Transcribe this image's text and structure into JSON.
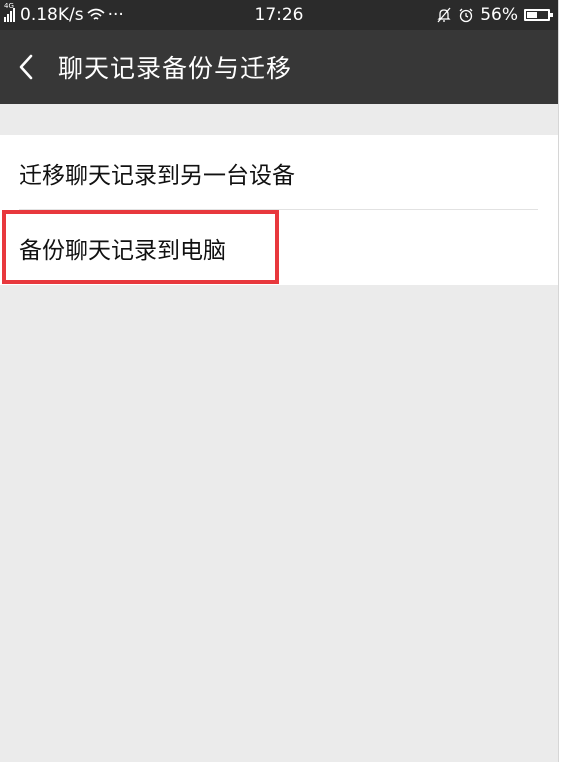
{
  "status_bar": {
    "network_type": "4G",
    "speed": "0.18K/s",
    "more": "···",
    "time": "17:26",
    "battery_percent": "56%",
    "battery_level": 0.56
  },
  "header": {
    "title": "聊天记录备份与迁移"
  },
  "list": {
    "items": [
      {
        "label": "迁移聊天记录到另一台设备"
      },
      {
        "label": "备份聊天记录到电脑"
      }
    ]
  },
  "colors": {
    "status_bar_bg": "#2b2b2b",
    "header_bg": "#373737",
    "page_bg": "#ebebeb",
    "highlight": "#e8383d"
  }
}
